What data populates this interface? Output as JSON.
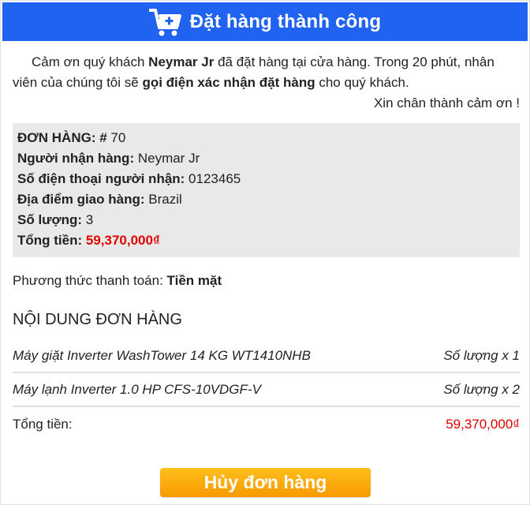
{
  "header": {
    "title": "Đặt hàng thành công",
    "icon": "cart-plus-icon"
  },
  "thanks": {
    "part1": "Cảm ơn quý khách ",
    "customer": "Neymar Jr",
    "part2": " đã đặt hàng tại cửa hàng. Trong 20 phút, nhân viên của chúng tôi sẽ ",
    "action": "gọi điện xác nhận đặt hàng",
    "part3": " cho quý khách.",
    "sign": "Xin chân thành cảm ơn !"
  },
  "order": {
    "id_label": "ĐƠN HÀNG: #",
    "id": " 70",
    "receiver_label": "Người nhận hàng:",
    "receiver": " Neymar Jr",
    "phone_label": "Số điện thoại người nhận:",
    "phone": " 0123465",
    "address_label": "Địa điểm giao hàng:",
    "address": " Brazil",
    "qty_label": "Số lượng:",
    "qty": " 3",
    "total_label": "Tổng tiền:",
    "total": " 59,370,000₫"
  },
  "payment": {
    "label": "Phương thức thanh toán: ",
    "value": "Tiền mặt"
  },
  "content": {
    "title": "NỘI DUNG ĐƠN HÀNG",
    "items": [
      {
        "name": "Máy giặt Inverter WashTower 14 KG WT1410NHB",
        "qty": "Số lượng x 1"
      },
      {
        "name": "Máy lạnh Inverter 1.0 HP CFS-10VDGF-V",
        "qty": "Số lượng x 2"
      }
    ],
    "total_label": "Tổng tiền:",
    "total": "59,370,000₫"
  },
  "buttons": {
    "cancel": "Hủy đơn hàng"
  },
  "colors": {
    "header": "#1f63f0",
    "price": "#e00000",
    "button": "#f9a80c"
  }
}
